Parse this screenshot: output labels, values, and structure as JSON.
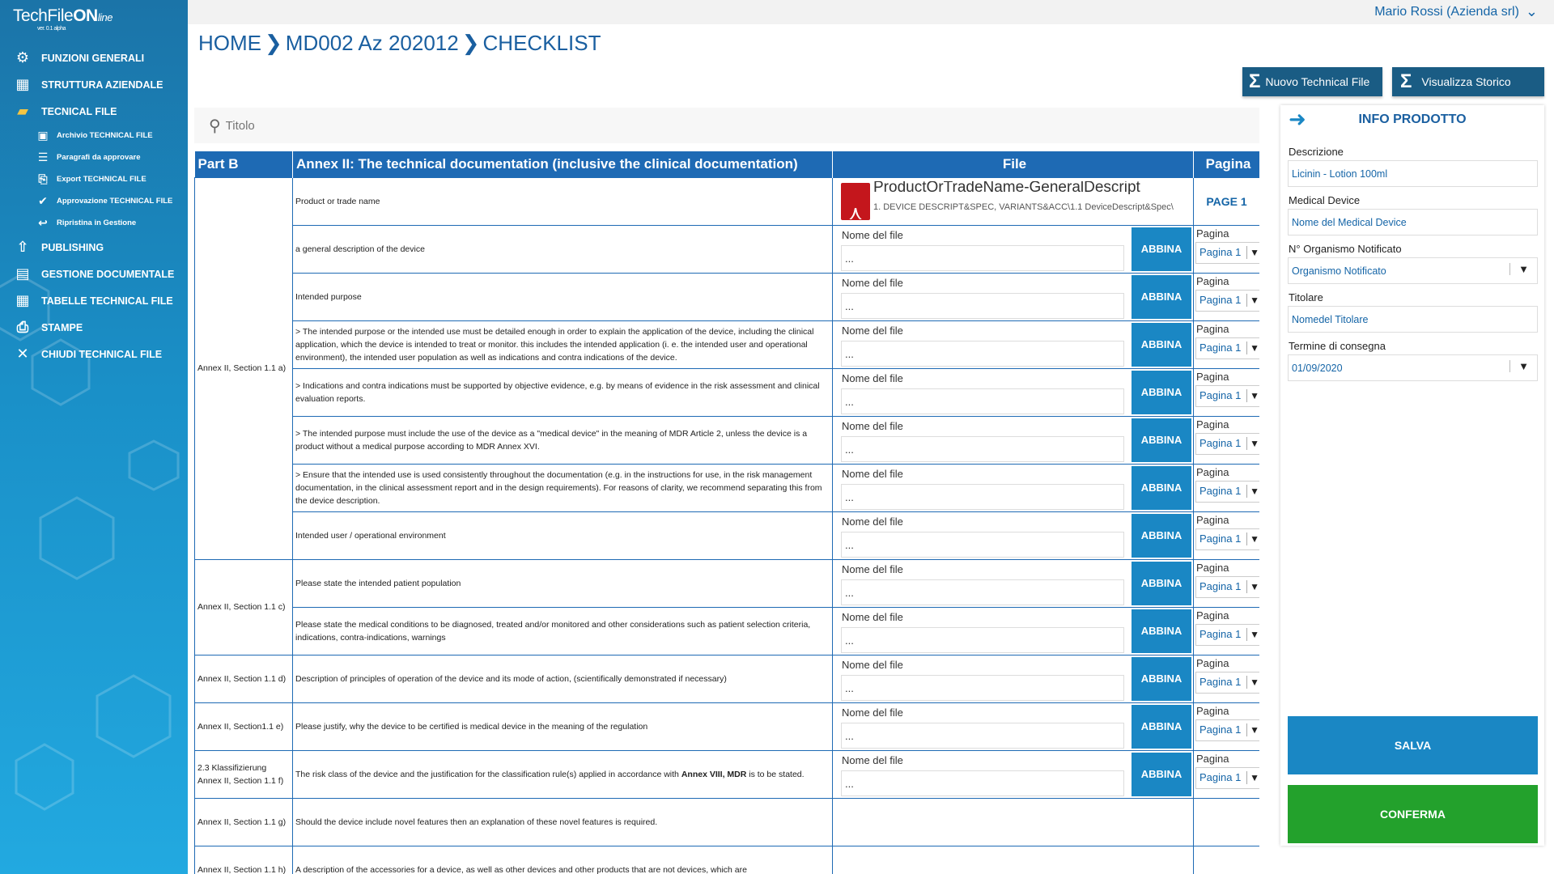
{
  "app": {
    "logo_a": "TechFile",
    "logo_b": "ON",
    "logo_c": "line",
    "version": "ver. 0.1 alpha"
  },
  "sidebar": {
    "items": [
      {
        "label": "FUNZIONI GENERALI",
        "icon": "gear-icon"
      },
      {
        "label": "STRUTTURA AZIENDALE",
        "icon": "building-icon"
      },
      {
        "label": "TECNICAL FILE",
        "icon": "folder-open-icon"
      }
    ],
    "subitems": [
      {
        "label": "Archivio TECHNICAL FILE",
        "icon": "archive-icon"
      },
      {
        "label": "Paragrafi da approvare",
        "icon": "list-icon"
      },
      {
        "label": "Export TECHNICAL FILE",
        "icon": "export-icon"
      },
      {
        "label": "Approvazione TECHNICAL FILE",
        "icon": "check-icon"
      },
      {
        "label": "Ripristina in Gestione",
        "icon": "undo-icon"
      }
    ],
    "items2": [
      {
        "label": "PUBLISHING",
        "icon": "upload-icon"
      },
      {
        "label": "GESTIONE DOCUMENTALE",
        "icon": "document-icon"
      },
      {
        "label": "TABELLE TECHNICAL FILE",
        "icon": "table-icon"
      },
      {
        "label": "STAMPE",
        "icon": "printer-icon"
      },
      {
        "label": "CHIUDI TECHNICAL FILE",
        "icon": "close-icon"
      }
    ]
  },
  "topbar": {
    "user": "Mario Rossi (Azienda srl)"
  },
  "breadcrumb": [
    "HOME",
    "MD002 Az 202012",
    "CHECKLIST"
  ],
  "buttons": {
    "nuovo": "Nuovo Technical File",
    "storico": "Visualizza Storico"
  },
  "search": {
    "placeholder": "Titolo"
  },
  "table": {
    "headers": [
      "Part B",
      "Annex II:  The technical documentation (inclusive the clinical documentation)",
      "File",
      "Pagina"
    ],
    "file_label": "Nome del file",
    "file_placeholder": "...",
    "abbina": "ABBINA",
    "pag_label": "Pagina",
    "pag_value": "Pagina 1",
    "first_file": {
      "name": "ProductOrTradeName-GeneralDescript",
      "path": "1. DEVICE DESCRIPT&SPEC, VARIANTS&ACC\\1.1 DeviceDescript&Spec\\",
      "page": "PAGE 1"
    },
    "sections": [
      "Annex II, Section 1.1 a)",
      "Annex II, Section 1.1 c)",
      "Annex II, Section 1.1 d)",
      "Annex II, Section1.1 e)",
      "2.3 Klassifizierung Annex II, Section 1.1 f)",
      "Annex II, Section 1.1 g)",
      "Annex II, Section 1.1 h)"
    ],
    "rows": [
      "Product or trade name",
      "a general description of the device",
      "Intended purpose",
      "> The intended purpose or the intended use must be detailed enough in order to explain the application of the device, including the clinical application, which the device is intended to treat or monitor. this includes the intended application (i. e. the intended user and operational environment), the intended user population as well as indications and contra indications of the device.",
      "> Indications and contra indications must be supported by objective evidence, e.g. by means of evidence in the risk assessment and clinical evaluation reports.",
      "> The intended purpose must include the use of the device as a \"medical device\" in the meaning of MDR Article 2, unless the device is a product without a medical purpose according to MDR Annex XVI.",
      "> Ensure that the intended use is used consistently throughout the documentation (e.g. in the instructions for use, in the risk management documentation, in the clinical assessment report and in the design requirements). For reasons of clarity, we recommend separating this from the device description.",
      "Intended user / operational environment",
      "Please state the intended patient population",
      "Please state the medical conditions to be diagnosed, treated and/or monitored and other considerations such as patient selection criteria, indications, contra-indications, warnings",
      "Description of principles of operation of the device and its mode of action, (scientifically demonstrated if necessary)",
      "Please justify, why the device to be certified is medical device in the meaning of the regulation",
      "The risk class of the device and the justification for the classification rule(s) applied in accordance with",
      "Should the device include novel features then an explanation of these novel features is required.",
      "A description of the accessories for a device, as well as other devices and other products that are not devices, which are"
    ],
    "risk_bold": "Annex VIII, MDR",
    "risk_tail": " is to be stated."
  },
  "panel": {
    "title": "INFO PRODOTTO",
    "fields": [
      {
        "label": "Descrizione",
        "value": "Licinin - Lotion 100ml"
      },
      {
        "label": "Medical Device",
        "value": "Nome del Medical Device"
      },
      {
        "label": "N° Organismo Notificato",
        "value": "Organismo Notificato"
      },
      {
        "label": "Titolare",
        "value": "Nomedel Titolare"
      },
      {
        "label": "Termine di consegna",
        "value": "01/09/2020"
      }
    ],
    "salva": "SALVA",
    "conferma": "CONFERMA"
  },
  "colors": {
    "primary": "#1a87c4",
    "header": "#1e6ab4",
    "dark_button": "#1a5c84",
    "confirm": "#23a12c"
  }
}
